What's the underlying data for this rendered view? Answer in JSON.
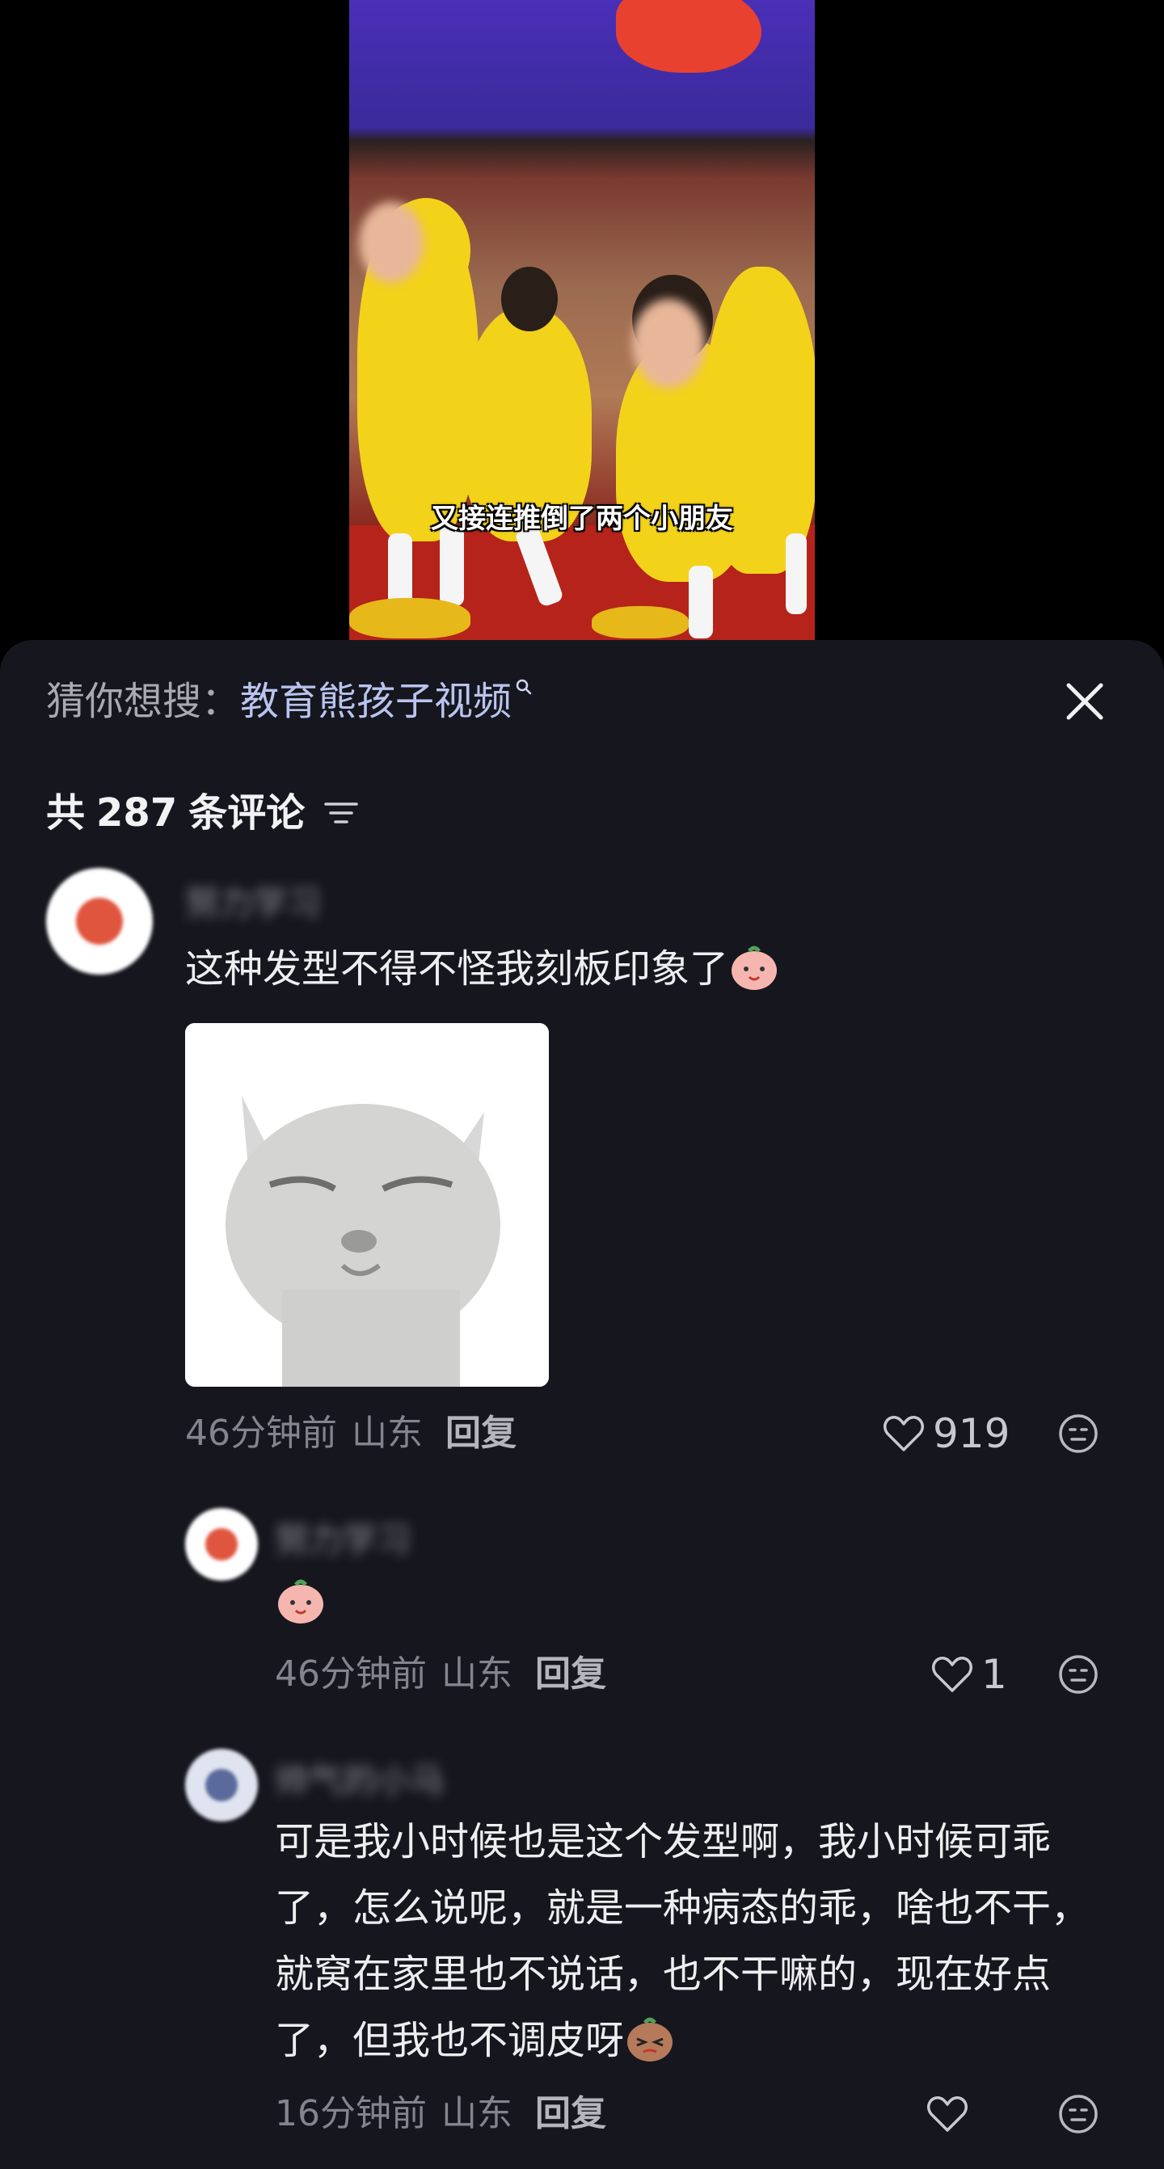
{
  "video": {
    "subtitle": "又接连推倒了两个小朋友"
  },
  "panel": {
    "suggest_label": "猜你想搜：",
    "suggest_query": "教育熊孩子视频",
    "count_prefix": "共",
    "count_number": "287",
    "count_suffix": "条评论"
  },
  "comments": [
    {
      "username": "努力学习",
      "text": "这种发型不得不怪我刻板印象了",
      "time": "46分钟前",
      "location": "山东",
      "reply_label": "回复",
      "likes": "919"
    },
    {
      "username": "努力学习",
      "text": "",
      "time": "46分钟前",
      "location": "山东",
      "reply_label": "回复",
      "likes": "1"
    },
    {
      "username": "帅气的小马",
      "text": "可是我小时候也是这个发型啊，我小时候可乖了，怎么说呢，就是一种病态的乖，啥也不干，就窝在家里也不说话，也不干嘛的，现在好点了，但我也不调皮呀",
      "time": "16分钟前",
      "location": "山东",
      "reply_label": "回复",
      "likes": ""
    }
  ],
  "colors": {
    "panel_bg": "#16161e",
    "query_color": "#b9c4ee",
    "meta_color": "#84848e"
  },
  "icons": [
    "close-icon",
    "sort-icon",
    "heart-icon",
    "emoji-reply-icon",
    "search-mini-icon"
  ]
}
